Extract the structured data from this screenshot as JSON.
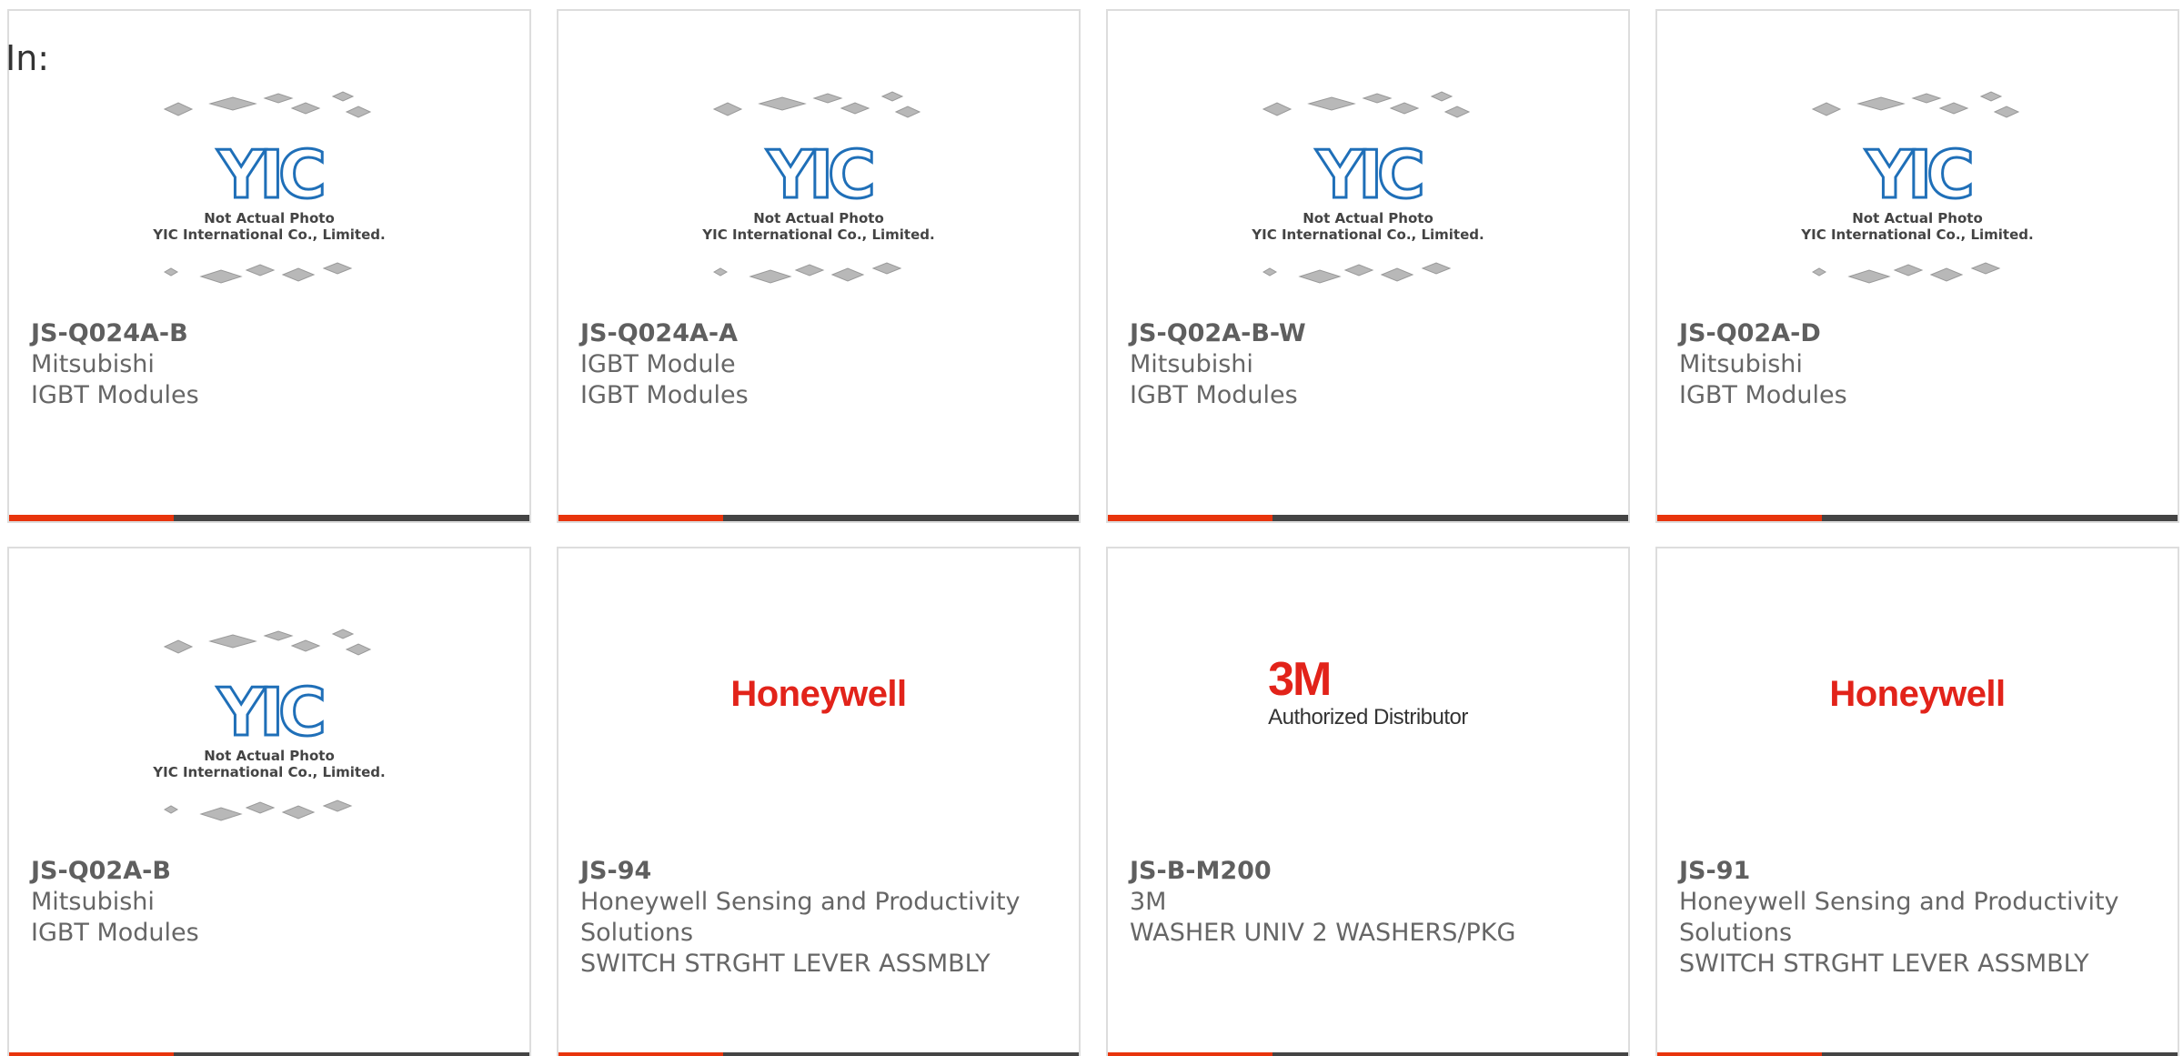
{
  "page": {
    "label": "In:"
  },
  "placeholder": {
    "line1": "Not Actual Photo",
    "line2": "YIC International Co., Limited.",
    "logo_text": "YIC"
  },
  "brands": {
    "honeywell": "Honeywell",
    "threem": "3M",
    "threem_sub": "Authorized Distributor"
  },
  "colors": {
    "accent": "#e8340c",
    "bar": "#444444",
    "yic_blue": "#1f6fb8",
    "brand_red": "#e2231a"
  },
  "products": [
    {
      "part": "JS-Q024A-B",
      "manufacturer": "Mitsubishi",
      "category": "IGBT Modules",
      "image": "placeholder"
    },
    {
      "part": "JS-Q024A-A",
      "manufacturer": "IGBT Module",
      "category": "IGBT Modules",
      "image": "placeholder"
    },
    {
      "part": "JS-Q02A-B-W",
      "manufacturer": "Mitsubishi",
      "category": "IGBT Modules",
      "image": "placeholder"
    },
    {
      "part": "JS-Q02A-D",
      "manufacturer": "Mitsubishi",
      "category": "IGBT Modules",
      "image": "placeholder"
    },
    {
      "part": "JS-Q02A-B",
      "manufacturer": "Mitsubishi",
      "category": "IGBT Modules",
      "image": "placeholder"
    },
    {
      "part": "JS-94",
      "manufacturer": "Honeywell Sensing and Productivity Solutions",
      "category": "SWITCH STRGHT LEVER ASSMBLY",
      "image": "honeywell"
    },
    {
      "part": "JS-B-M200",
      "manufacturer": "3M",
      "category": "WASHER UNIV 2 WASHERS/PKG",
      "image": "3m"
    },
    {
      "part": "JS-91",
      "manufacturer": "Honeywell Sensing and Productivity Solutions",
      "category": "SWITCH STRGHT LEVER ASSMBLY",
      "image": "honeywell"
    }
  ]
}
